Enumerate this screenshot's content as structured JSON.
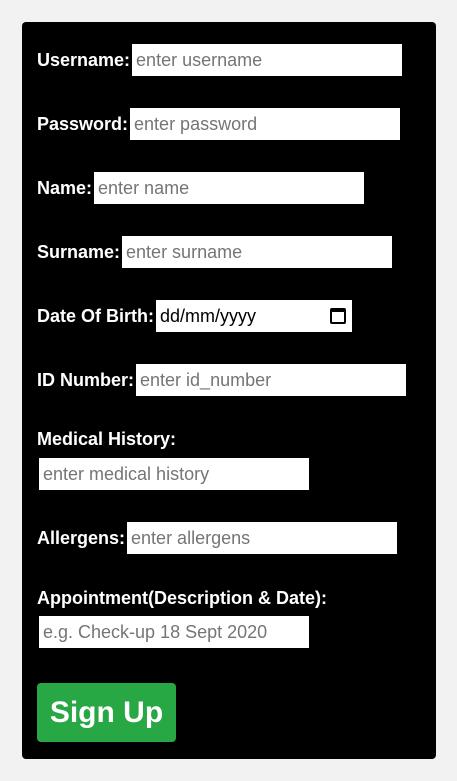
{
  "form": {
    "username": {
      "label": "Username:",
      "placeholder": "enter username"
    },
    "password": {
      "label": "Password:",
      "placeholder": "enter password"
    },
    "name": {
      "label": "Name:",
      "placeholder": "enter name"
    },
    "surname": {
      "label": "Surname:",
      "placeholder": "enter surname"
    },
    "dob": {
      "label": "Date Of Birth:",
      "value": "dd/mm/yyyy",
      "icon": "calendar-icon"
    },
    "id_number": {
      "label": "ID Number:",
      "placeholder": "enter id_number"
    },
    "medical_history": {
      "label": "Medical History:",
      "placeholder": "enter medical history"
    },
    "allergens": {
      "label": "Allergens:",
      "placeholder": "enter allergens"
    },
    "appointment": {
      "label": "Appointment(Description & Date):",
      "placeholder": "e.g. Check-up 18 Sept 2020"
    },
    "submit_label": "Sign Up"
  },
  "colors": {
    "panel_bg": "#000000",
    "page_bg": "#f2f2f2",
    "button_bg": "#28a745",
    "label_text": "#ffffff"
  }
}
